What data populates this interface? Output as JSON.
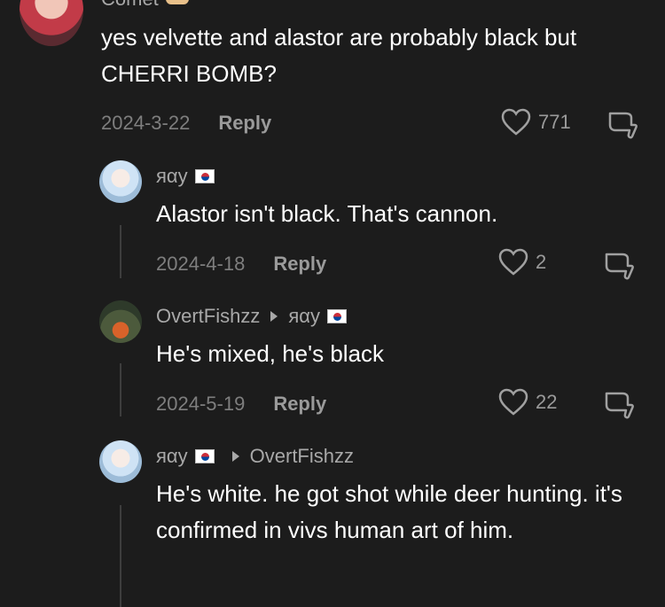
{
  "top_comment": {
    "username_partial": "Comet",
    "text": "yes velvette and alastor are probably black but CHERRI BOMB?",
    "date": "2024-3-22",
    "reply_label": "Reply",
    "likes": "771"
  },
  "replies": [
    {
      "username": "яαу",
      "text": "Alastor isn't black. That's cannon.",
      "date": "2024-4-18",
      "reply_label": "Reply",
      "likes": "2"
    },
    {
      "username": "OvertFishzz",
      "reply_to": "яαу",
      "text": "He's mixed, he's black",
      "date": "2024-5-19",
      "reply_label": "Reply",
      "likes": "22"
    },
    {
      "username": "яαу",
      "reply_to": "OvertFishzz",
      "text": "He's white. he got shot while deer hunting. it's confirmed in vivs human art of him."
    }
  ],
  "colors": {
    "background": "#1c1c1c",
    "username": "#a8a8a8",
    "meta": "#7e7e7e"
  }
}
